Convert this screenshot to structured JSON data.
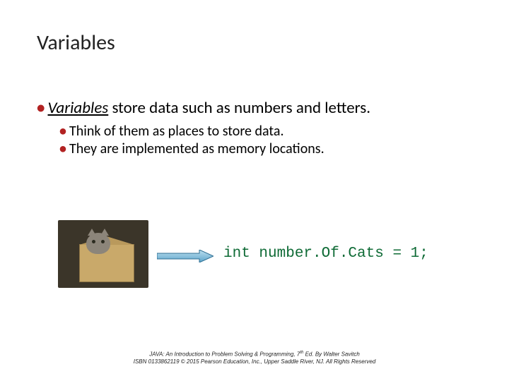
{
  "title": "Variables",
  "bullets": {
    "main": {
      "emph": "Variables",
      "rest": " store data such as numbers and letters."
    },
    "sub1": "Think of them as places to store data.",
    "sub2": "They are implemented as memory locations."
  },
  "code": "int number.Of.Cats = 1;",
  "footer": {
    "line1_a": "JAVA: An Introduction to Problem Solving & Programming, 7",
    "line1_sup": "th",
    "line1_b": " Ed. By Walter Savitch",
    "line2": "ISBN 0133862119 © 2015 Pearson Education, Inc., Upper Saddle River, NJ. All Rights Reserved"
  }
}
